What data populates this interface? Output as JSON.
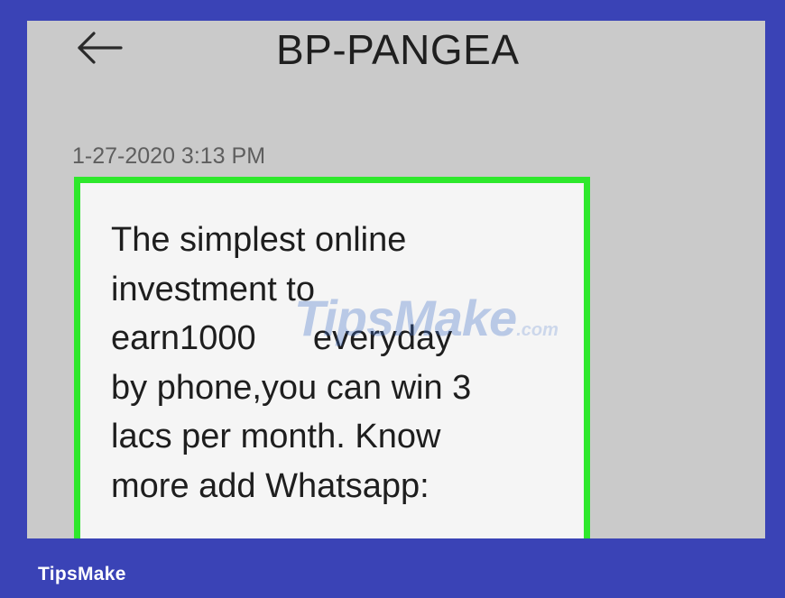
{
  "header": {
    "back_icon": "arrow-left-icon",
    "title": "BP-PANGEA"
  },
  "conversation": {
    "timestamp": "1-27-2020 3:13 PM",
    "message": {
      "lines": [
        "The simplest online",
        "investment to",
        "earn1000      everyday",
        "by phone,you can win 3",
        "lacs per month. Know",
        "more add Whatsapp:"
      ],
      "highlight_color": "#2ee82c"
    }
  },
  "watermark": {
    "text": "TipsMake",
    "suffix": ".com"
  },
  "footer": {
    "brand": "TipsMake"
  },
  "colors": {
    "frame": "#3a43b6",
    "screen_background": "#cacaca",
    "bubble_background": "#f5f5f5"
  }
}
